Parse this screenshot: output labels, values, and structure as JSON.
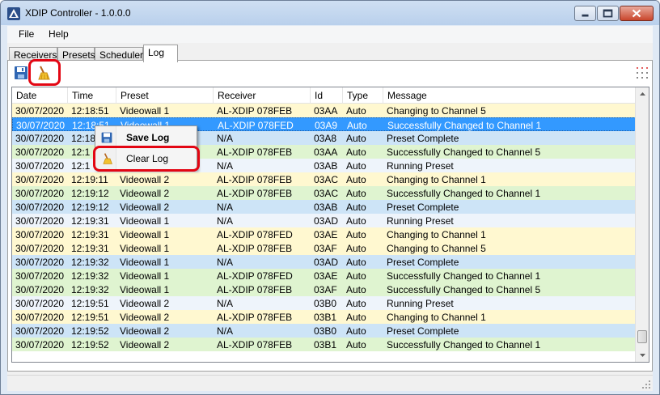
{
  "window": {
    "title": "XDIP Controller - 1.0.0.0"
  },
  "menu": {
    "items": [
      "File",
      "Help"
    ]
  },
  "tabs": [
    "Receivers",
    "Presets",
    "Scheduler",
    "Log"
  ],
  "active_tab": 3,
  "toolbar": {
    "icons": [
      "save-icon",
      "broom-icon",
      "grid-dots-icon"
    ]
  },
  "grid": {
    "columns": [
      "Date",
      "Time",
      "Preset",
      "Receiver",
      "Id",
      "Type",
      "Message"
    ],
    "rows": [
      [
        "30/07/2020",
        "12:18:51",
        "Videowall 1",
        "AL-XDIP 078FEB",
        "03AA",
        "Auto",
        "Changing to Channel 5"
      ],
      [
        "30/07/2020",
        "12:18:51",
        "Videowall 1",
        "AL-XDIP 078FED",
        "03A9",
        "Auto",
        "Successfully Changed to Channel 1"
      ],
      [
        "30/07/2020",
        "12:18:",
        "",
        "N/A",
        "03A8",
        "Auto",
        "Preset Complete"
      ],
      [
        "30/07/2020",
        "12:1",
        "",
        "AL-XDIP 078FEB",
        "03AA",
        "Auto",
        "Successfully Changed to Channel 5"
      ],
      [
        "30/07/2020",
        "12:1",
        "",
        "N/A",
        "03AB",
        "Auto",
        "Running Preset"
      ],
      [
        "30/07/2020",
        "12:19:11",
        "Videowall 2",
        "AL-XDIP 078FEB",
        "03AC",
        "Auto",
        "Changing to Channel 1"
      ],
      [
        "30/07/2020",
        "12:19:12",
        "Videowall 2",
        "AL-XDIP 078FEB",
        "03AC",
        "Auto",
        "Successfully Changed to Channel 1"
      ],
      [
        "30/07/2020",
        "12:19:12",
        "Videowall 2",
        "N/A",
        "03AB",
        "Auto",
        "Preset Complete"
      ],
      [
        "30/07/2020",
        "12:19:31",
        "Videowall 1",
        "N/A",
        "03AD",
        "Auto",
        "Running Preset"
      ],
      [
        "30/07/2020",
        "12:19:31",
        "Videowall 1",
        "AL-XDIP 078FED",
        "03AE",
        "Auto",
        "Changing to Channel 1"
      ],
      [
        "30/07/2020",
        "12:19:31",
        "Videowall 1",
        "AL-XDIP 078FEB",
        "03AF",
        "Auto",
        "Changing to Channel 5"
      ],
      [
        "30/07/2020",
        "12:19:32",
        "Videowall 1",
        "N/A",
        "03AD",
        "Auto",
        "Preset Complete"
      ],
      [
        "30/07/2020",
        "12:19:32",
        "Videowall 1",
        "AL-XDIP 078FED",
        "03AE",
        "Auto",
        "Successfully Changed to Channel 1"
      ],
      [
        "30/07/2020",
        "12:19:32",
        "Videowall 1",
        "AL-XDIP 078FEB",
        "03AF",
        "Auto",
        "Successfully Changed to Channel 5"
      ],
      [
        "30/07/2020",
        "12:19:51",
        "Videowall 2",
        "N/A",
        "03B0",
        "Auto",
        "Running Preset"
      ],
      [
        "30/07/2020",
        "12:19:51",
        "Videowall 2",
        "AL-XDIP 078FEB",
        "03B1",
        "Auto",
        "Changing to Channel 1"
      ],
      [
        "30/07/2020",
        "12:19:52",
        "Videowall 2",
        "N/A",
        "03B0",
        "Auto",
        "Preset Complete"
      ],
      [
        "30/07/2020",
        "12:19:52",
        "Videowall 2",
        "AL-XDIP 078FEB",
        "03B1",
        "Auto",
        "Successfully Changed to Channel 1"
      ]
    ],
    "selected_row": 1
  },
  "row_colors": {
    "Changing": "#fff8d0",
    "Successfully": "#dff4d0",
    "Preset Complete": "#cde4f7",
    "Running Preset": "#eef4fb",
    "selected": "#3399ff"
  },
  "context_menu": {
    "items": [
      {
        "label": "Save Log",
        "icon": "save-icon"
      },
      {
        "label": "Clear Log",
        "icon": "broom-icon"
      }
    ]
  },
  "accent": "#e30613"
}
